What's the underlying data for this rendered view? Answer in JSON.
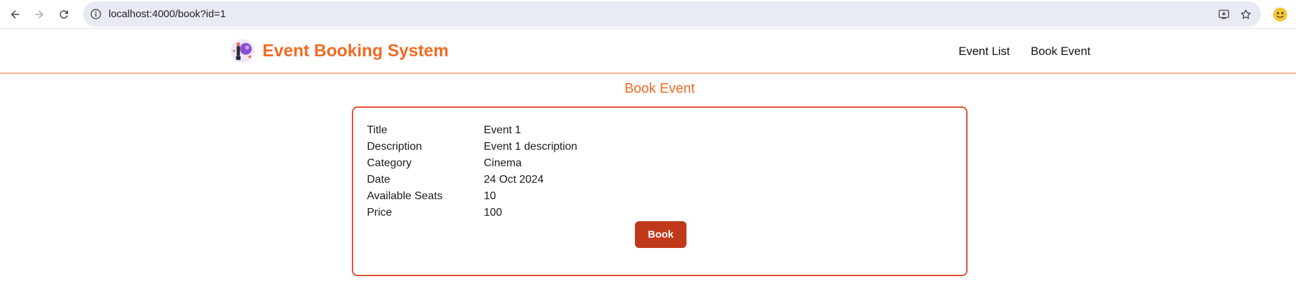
{
  "browser": {
    "url": "localhost:4000/book?id=1"
  },
  "header": {
    "brand_name": "Event Booking System",
    "nav": [
      {
        "label": "Event List"
      },
      {
        "label": "Book Event"
      }
    ]
  },
  "main": {
    "title": "Book Event",
    "details": [
      {
        "label": "Title",
        "value": "Event 1"
      },
      {
        "label": "Description",
        "value": "Event 1 description"
      },
      {
        "label": "Category",
        "value": "Cinema"
      },
      {
        "label": "Date",
        "value": "24 Oct 2024"
      },
      {
        "label": "Available Seats",
        "value": "10"
      },
      {
        "label": "Price",
        "value": "100"
      }
    ],
    "book_button_label": "Book"
  },
  "colors": {
    "accent": "#f26a22",
    "card_border": "#e0502e",
    "button": "#c0391b"
  }
}
